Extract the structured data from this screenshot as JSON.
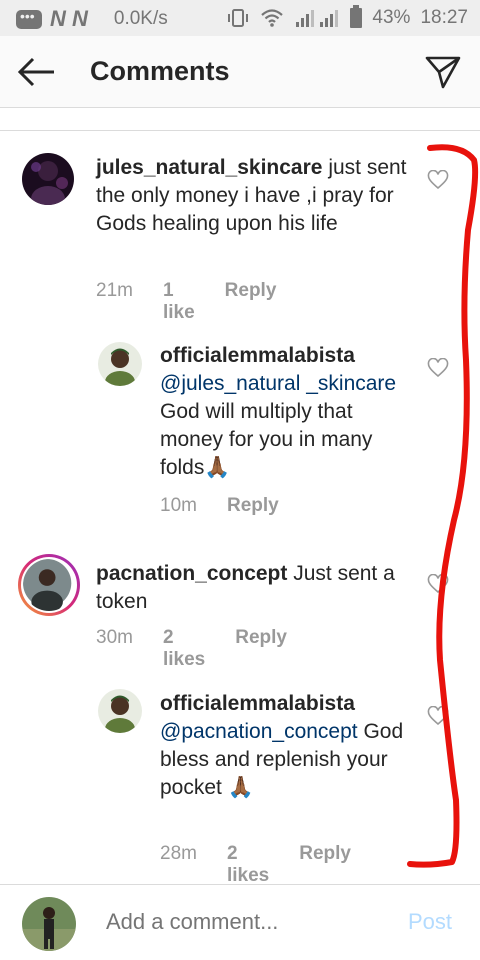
{
  "status_bar": {
    "n_label": "N N",
    "speed": "0.0K/s",
    "battery": "43%",
    "time": "18:27"
  },
  "header": {
    "title": "Comments"
  },
  "comments": [
    {
      "username": "jules_natural_skincare",
      "text": "just sent the only money i have ,i pray for Gods healing upon his life",
      "time": "21m",
      "likes": "1 like",
      "reply": "Reply"
    },
    {
      "username": "officialemmalabista",
      "mention": "@jules_natural _skincare",
      "text": "God will multiply that money for you in many folds🙏🏾",
      "time": "10m",
      "reply": "Reply"
    },
    {
      "username": "pacnation_concept",
      "text": "Just sent a token",
      "time": "30m",
      "likes": "2 likes",
      "reply": "Reply"
    },
    {
      "username": "officialemmalabista",
      "mention": "@pacnation_concept",
      "text": "God bless and replenish your pocket 🙏🏾",
      "time": "28m",
      "likes": "2 likes",
      "reply": "Reply"
    }
  ],
  "add_comment": {
    "placeholder": "Add a comment...",
    "post_label": "Post"
  },
  "colors": {
    "annotation": "#e8120c",
    "mention": "#003569",
    "meta": "#999999",
    "post": "#b3dbff"
  }
}
